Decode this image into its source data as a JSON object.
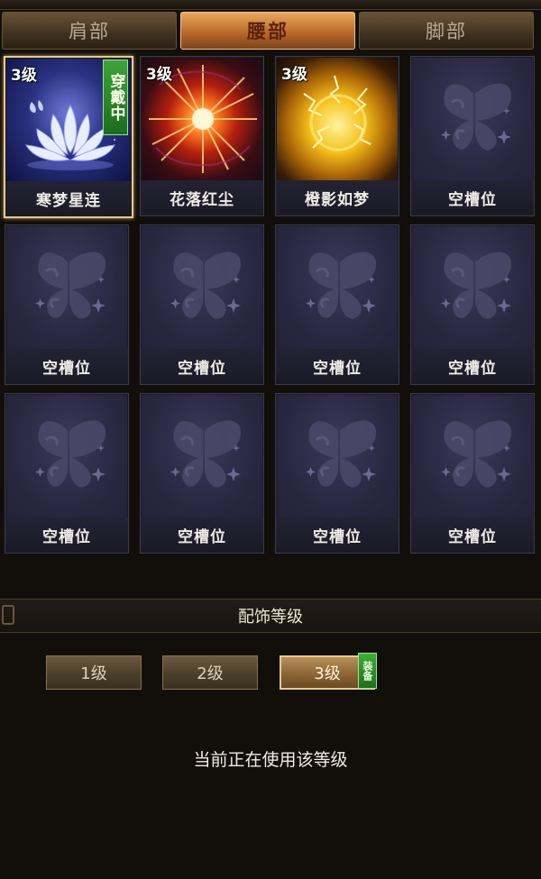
{
  "tabs": [
    {
      "label": "肩部",
      "active": false
    },
    {
      "label": "腰部",
      "active": true
    },
    {
      "label": "脚部",
      "active": false
    }
  ],
  "slots": [
    {
      "name": "寒梦星连",
      "level": "3级",
      "worn": "穿戴中",
      "icon": "lotus-icon"
    },
    {
      "name": "花落红尘",
      "level": "3级",
      "icon": "red-burst-icon"
    },
    {
      "name": "橙影如梦",
      "level": "3级",
      "icon": "golden-lightning-orb-icon"
    },
    {
      "name": "空槽位",
      "icon": "butterfly-placeholder-icon"
    },
    {
      "name": "空槽位",
      "icon": "butterfly-placeholder-icon"
    },
    {
      "name": "空槽位",
      "icon": "butterfly-placeholder-icon"
    },
    {
      "name": "空槽位",
      "icon": "butterfly-placeholder-icon"
    },
    {
      "name": "空槽位",
      "icon": "butterfly-placeholder-icon"
    },
    {
      "name": "空槽位",
      "icon": "butterfly-placeholder-icon"
    },
    {
      "name": "空槽位",
      "icon": "butterfly-placeholder-icon"
    },
    {
      "name": "空槽位",
      "icon": "butterfly-placeholder-icon"
    },
    {
      "name": "空槽位",
      "icon": "butterfly-placeholder-icon"
    }
  ],
  "section": {
    "title": "配饰等级"
  },
  "levels": [
    {
      "label": "1级",
      "active": false
    },
    {
      "label": "2级",
      "active": false
    },
    {
      "label": "3级",
      "active": true,
      "badge": "装备"
    }
  ],
  "status_text": "当前正在使用该等级",
  "colors": {
    "accent": "#e8c98a",
    "active_tab": "#c8782f",
    "equip_green": "#2f8f2c"
  }
}
